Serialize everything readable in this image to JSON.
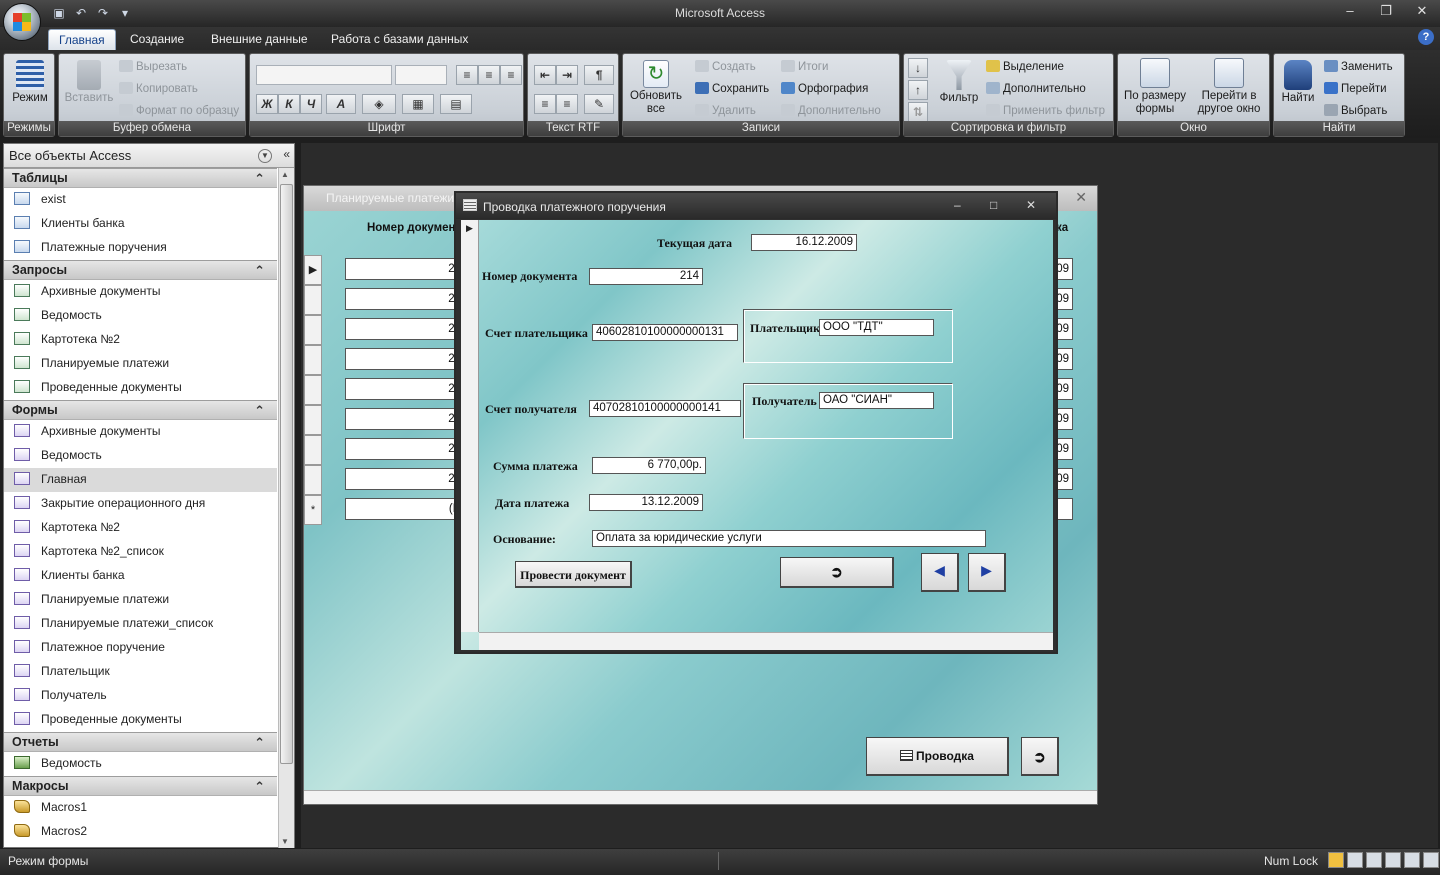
{
  "app": {
    "title": "Microsoft Access",
    "status_left": "Режим формы",
    "status_right": "Num Lock"
  },
  "ribbon": {
    "tabs": [
      "Главная",
      "Создание",
      "Внешние данные",
      "Работа с базами данных"
    ],
    "groups": {
      "modes": {
        "label": "Режимы",
        "button": "Режим"
      },
      "clipboard": {
        "label": "Буфер обмена",
        "paste": "Вставить",
        "cut": "Вырезать",
        "copy": "Копировать",
        "format": "Формат по образцу"
      },
      "font": {
        "label": "Шрифт"
      },
      "rtf": {
        "label": "Текст RTF"
      },
      "records": {
        "label": "Записи",
        "refresh": "Обновить",
        "refresh2": "все",
        "create": "Создать",
        "save": "Сохранить",
        "delete": "Удалить",
        "totals": "Итоги",
        "spelling": "Орфография",
        "more": "Дополнительно"
      },
      "sort": {
        "label": "Сортировка и фильтр",
        "filter": "Фильтр",
        "selection": "Выделение",
        "advanced": "Дополнительно",
        "apply": "Применить фильтр"
      },
      "window": {
        "label": "Окно",
        "fit": "По размеру",
        "fit2": "формы",
        "switch": "Перейти в",
        "switch2": "другое окно"
      },
      "find": {
        "label": "Найти",
        "find": "Найти",
        "replace": "Заменить",
        "goto": "Перейти",
        "select": "Выбрать"
      }
    }
  },
  "nav": {
    "header": "Все объекты Access",
    "sections": [
      {
        "title": "Таблицы",
        "type": "t",
        "items": [
          "exist",
          "Клиенты банка",
          "Платежные поручения"
        ]
      },
      {
        "title": "Запросы",
        "type": "q",
        "items": [
          "Архивные документы",
          "Ведомость",
          "Картотека №2",
          "Планируемые платежи",
          "Проведенные документы"
        ]
      },
      {
        "title": "Формы",
        "type": "f",
        "items": [
          "Архивные документы",
          "Ведомость",
          "Главная",
          "Закрытие операционного дня",
          "Картотека №2",
          "Картотека №2_список",
          "Клиенты банка",
          "Планируемые платежи",
          "Планируемые платежи_список",
          "Платежное поручение",
          "Плательщик",
          "Получатель",
          "Проведенные документы"
        ]
      },
      {
        "title": "Отчеты",
        "type": "r",
        "items": [
          "Ведомость"
        ]
      },
      {
        "title": "Макросы",
        "type": "m",
        "items": [
          "Macros1",
          "Macros2"
        ]
      }
    ],
    "selected": "Главная"
  },
  "background_form": {
    "title": "Планируемые платежи",
    "col_header_left": "Номер докумен",
    "col_header_right": "ка",
    "rows_left": [
      "21",
      "22",
      "22",
      "22",
      "22",
      "22",
      "20",
      "20",
      "(N"
    ],
    "rows_right": [
      "09",
      "09",
      "09",
      "09",
      "09",
      "09",
      "09",
      "09",
      ""
    ],
    "post_button": "Проводка"
  },
  "dialog": {
    "title": "Проводка платежного поручения",
    "fields": {
      "current_date_label": "Текущая дата",
      "current_date": "16.12.2009",
      "doc_num_label": "Номер документа",
      "doc_num": "214",
      "payer_acc_label": "Счет плательщика",
      "payer_acc": "40602810100000000131",
      "payer_label": "Плательщик",
      "payer": "ООО \"ТДТ\"",
      "recv_acc_label": "Счет получателя",
      "recv_acc": "40702810100000000141",
      "recv_label": "Получатель",
      "recv": "ОАО \"СИАН\"",
      "sum_label": "Сумма платежа",
      "sum": "6 770,00р.",
      "pay_date_label": "Дата платежа",
      "pay_date": "13.12.2009",
      "basis_label": "Основание:",
      "basis": "Оплата за юридические услуги"
    },
    "post_doc_button": "Провести документ"
  }
}
